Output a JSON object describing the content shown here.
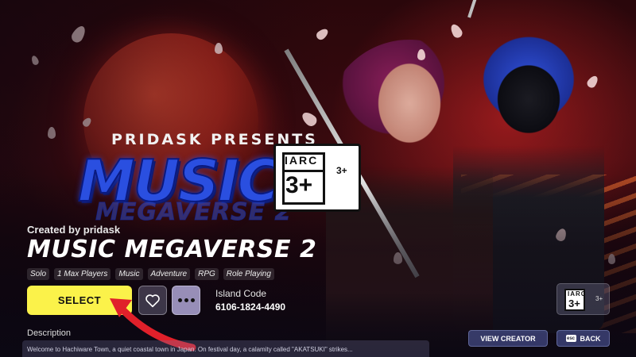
{
  "hero": {
    "presents_text": "PRIDASK PRESENTS",
    "logo_title": "MUSIC",
    "logo_subtitle": "MEGAVERSE 2"
  },
  "rating": {
    "system": "IARC",
    "age": "3+",
    "age_side": "3+"
  },
  "game": {
    "created_by": "Created by pridask",
    "title": "MUSIC MEGAVERSE 2",
    "tags": [
      "Solo",
      "1 Max Players",
      "Music",
      "Adventure",
      "RPG",
      "Role Playing"
    ]
  },
  "actions": {
    "select_label": "SELECT",
    "favorite_icon": "heart-icon",
    "more_icon": "more-dots-icon"
  },
  "island": {
    "label": "Island Code",
    "code": "6106-1824-4490"
  },
  "description": {
    "label": "Description",
    "text": "Welcome to Hachiware Town, a quiet coastal town in Japan. On festival day, a calamity called \"AKATSUKI\" strikes..."
  },
  "footer": {
    "view_creator_label": "VIEW CREATOR",
    "back_label": "BACK",
    "back_key": "esc"
  },
  "colors": {
    "select_button": "#fbf24a",
    "annotation_arrow": "#e0202a",
    "logo_blue": "#2a4fe0"
  }
}
